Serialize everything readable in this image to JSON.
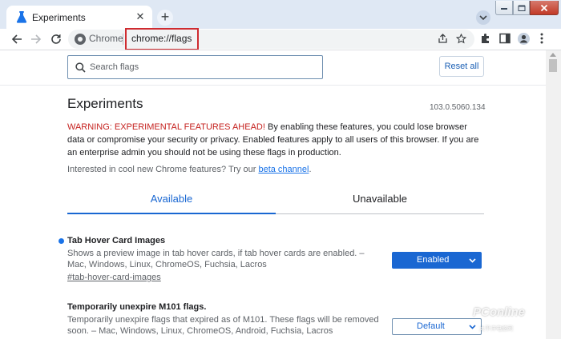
{
  "browser": {
    "tab_title": "Experiments",
    "omnibox_chip": "Chrome",
    "url": "chrome://flags"
  },
  "header": {
    "search_placeholder": "Search flags",
    "reset_label": "Reset all"
  },
  "page": {
    "title": "Experiments",
    "version": "103.0.5060.134",
    "warning_prefix": "WARNING: EXPERIMENTAL FEATURES AHEAD!",
    "warning_body": " By enabling these features, you could lose browser data or compromise your security or privacy. Enabled features apply to all users of this browser. If you are an enterprise admin you should not be using these flags in production.",
    "interested_text": "Interested in cool new Chrome features? Try our ",
    "beta_link": "beta channel",
    "interested_suffix": "."
  },
  "tabs": {
    "available": "Available",
    "unavailable": "Unavailable"
  },
  "flags": [
    {
      "title": "Tab Hover Card Images",
      "description": "Shows a preview image in tab hover cards, if tab hover cards are enabled. – Mac, Windows, Linux, ChromeOS, Fuchsia, Lacros",
      "anchor": "#tab-hover-card-images",
      "value": "Enabled"
    },
    {
      "title": "Temporarily unexpire M101 flags.",
      "description": "Temporarily unexpire flags that expired as of M101. These flags will be removed soon. – Mac, Windows, Linux, ChromeOS, Android, Fuchsia, Lacros",
      "value": "Default"
    }
  ],
  "watermark": {
    "brand": "PConline",
    "sub": "太平洋电脑网"
  },
  "colors": {
    "accent": "#1a73e8",
    "warning": "#c5221f",
    "highlight_box": "#cf2b30"
  }
}
